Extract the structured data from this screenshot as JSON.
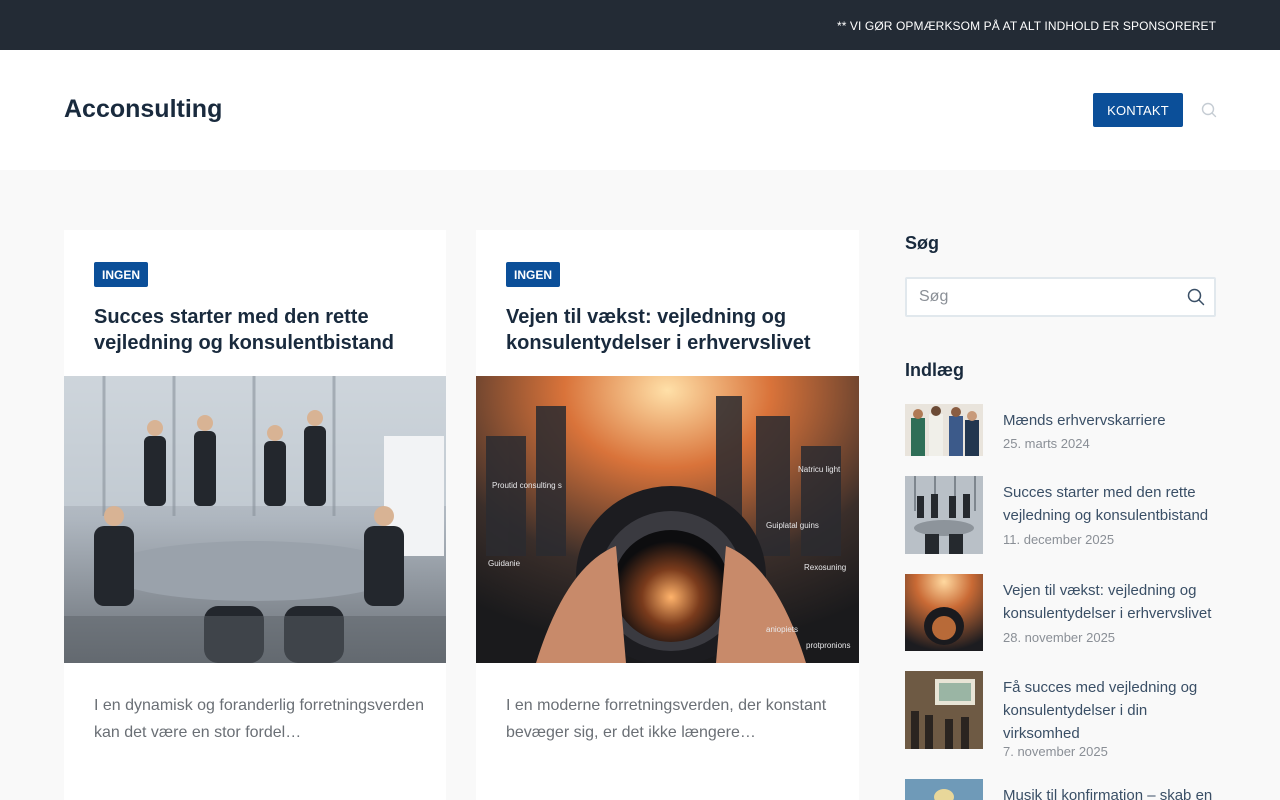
{
  "topbar": {
    "notice": "** VI GØR OPMÆRKSOM PÅ AT ALT INDHOLD ER SPONSORERET"
  },
  "header": {
    "logo": "Acconsulting",
    "contact_label": "KONTAKT"
  },
  "cards": [
    {
      "category": "INGEN",
      "title": "Succes starter med den rette vejledning og konsulentbistand",
      "excerpt": "I en dynamisk og foranderlig forretningsverden kan det være en stor fordel…"
    },
    {
      "category": "INGEN",
      "title": "Vejen til vækst: vejledning og konsulentydelser i erhvervslivet",
      "excerpt": "I en moderne forretningsverden, der konstant bevæger sig, er det ikke længere…",
      "image_labels": [
        "Proutid consulting s",
        "Natricu light",
        "Guiplatal guins",
        "Guidanie",
        "Rexosuning",
        "aniopiets",
        "protpronions"
      ]
    }
  ],
  "sidebar": {
    "search_title": "Søg",
    "search_placeholder": "Søg",
    "posts_title": "Indlæg",
    "posts": [
      {
        "title": "Mænds erhvervskarriere",
        "date": "25. marts 2024"
      },
      {
        "title": "Succes starter med den rette vejledning og konsulentbistand",
        "date": "11. december 2025"
      },
      {
        "title": "Vejen til vækst: vejledning og konsulentydelser i erhvervslivet",
        "date": "28. november 2025"
      },
      {
        "title": "Få succes med vejledning og konsulentydelser i din virksomhed",
        "date": "7. november 2025"
      },
      {
        "title": "Musik til konfirmation – skab en",
        "date": ""
      }
    ]
  },
  "colors": {
    "accent": "#0b4f99",
    "topbar": "#232b35",
    "heading": "#192a3d"
  },
  "icons": {
    "header_search": "search-icon",
    "widget_search": "search-icon"
  }
}
